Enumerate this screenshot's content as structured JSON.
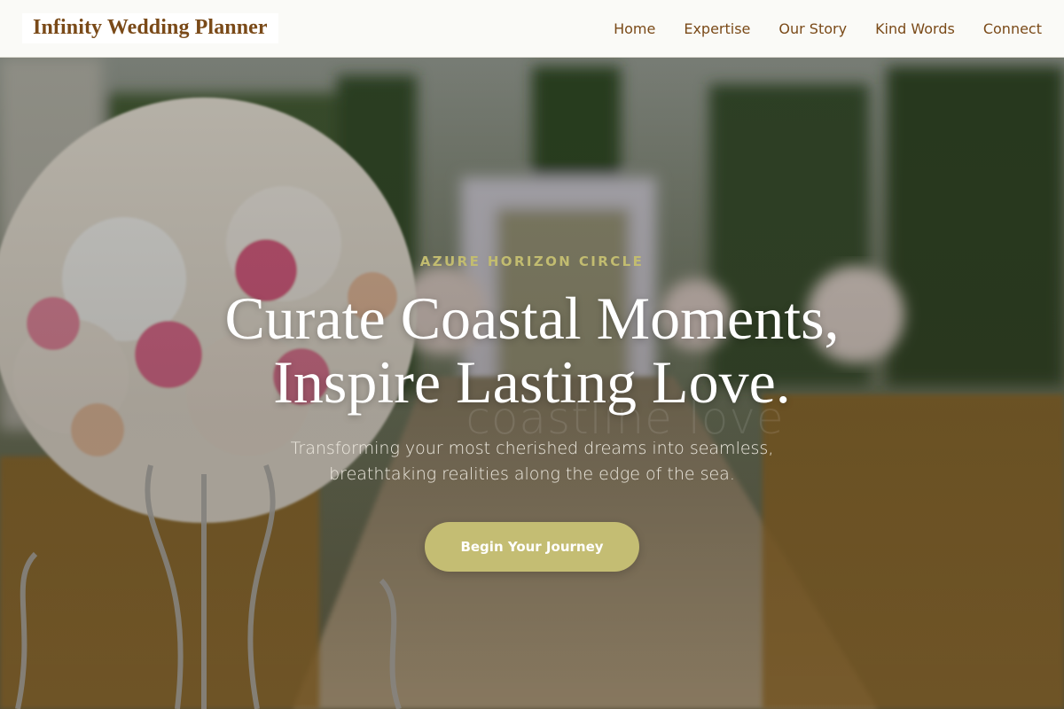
{
  "header": {
    "brand": "Infinity Wedding Planner",
    "nav": [
      "Home",
      "Expertise",
      "Our Story",
      "Kind Words",
      "Connect"
    ]
  },
  "hero": {
    "eyebrow": "AZURE HORIZON CIRCLE",
    "headline_lines": [
      "Curate Coastal Moments,",
      "Inspire Lasting Love."
    ],
    "ghost_text": "coastline love",
    "subtitle_lines": [
      "Transforming your most cherished dreams into seamless,",
      "breathtaking realities along the edge of the sea."
    ],
    "cta_label": "Begin Your Journey"
  },
  "colors": {
    "brand_text": "#7a4a18",
    "accent": "#c4bd73",
    "eyebrow": "#c2bc70",
    "header_bg": "#fafaf7"
  }
}
